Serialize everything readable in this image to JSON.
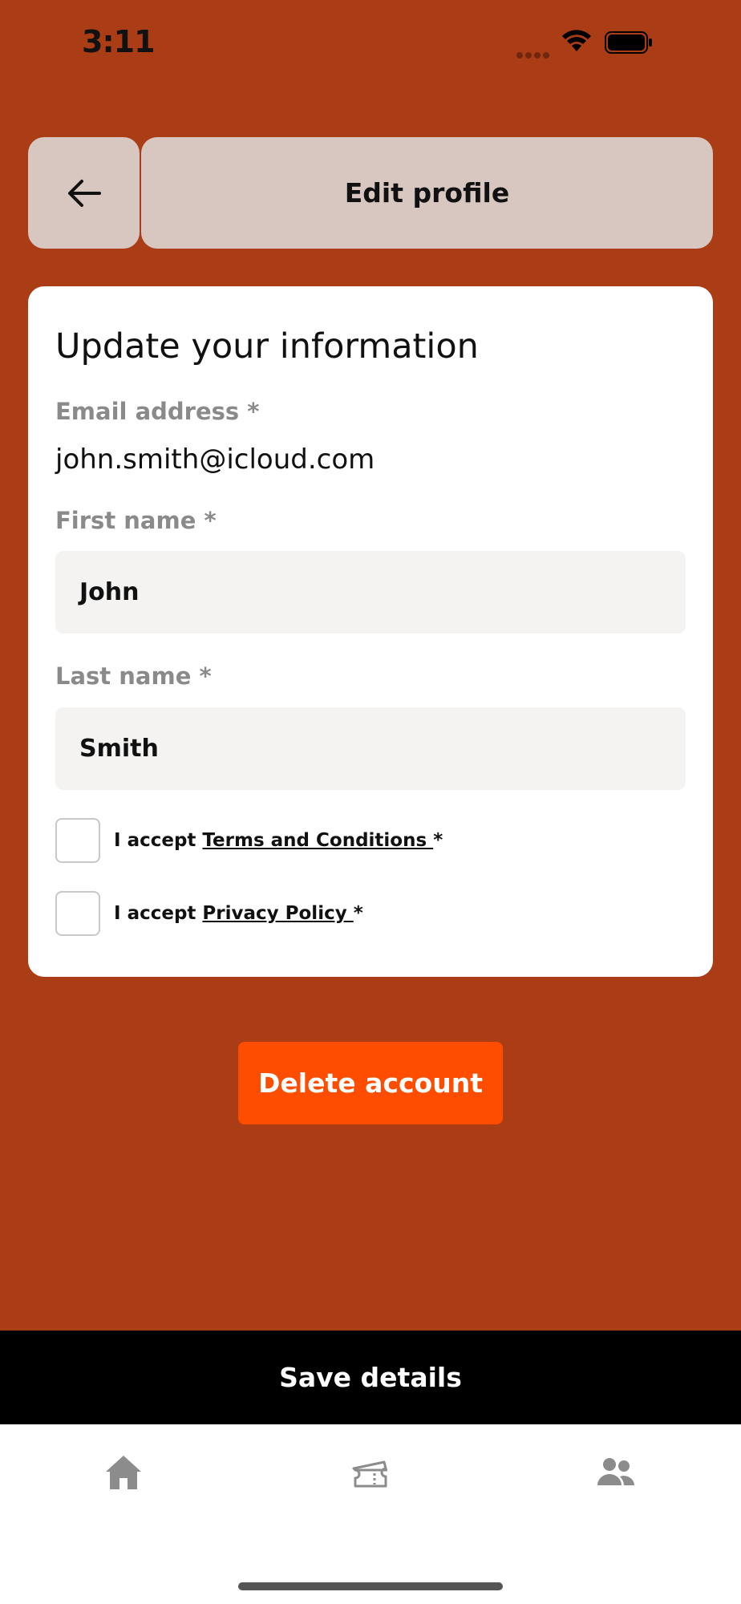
{
  "status_bar": {
    "time": "3:11"
  },
  "header": {
    "title": "Edit profile"
  },
  "form": {
    "heading": "Update your information",
    "email_label": "Email address *",
    "email_value": "john.smith@icloud.com",
    "first_name_label": "First name *",
    "first_name_value": "John",
    "last_name_label": "Last name *",
    "last_name_value": "Smith",
    "terms": {
      "prefix": "I accept ",
      "link": "Terms and Conditions ",
      "suffix": "*",
      "checked": false
    },
    "privacy": {
      "prefix": "I accept ",
      "link": "Privacy Policy ",
      "suffix": "*",
      "checked": false
    }
  },
  "actions": {
    "delete_label": "Delete account",
    "save_label": "Save details"
  },
  "tab_bar": {
    "items": [
      {
        "icon": "home-icon"
      },
      {
        "icon": "ticket-icon"
      },
      {
        "icon": "users-icon"
      }
    ]
  },
  "colors": {
    "background": "#ab3d16",
    "header_box": "#d8c6c0",
    "accent": "#ff4d00",
    "save_bar": "#000000"
  }
}
